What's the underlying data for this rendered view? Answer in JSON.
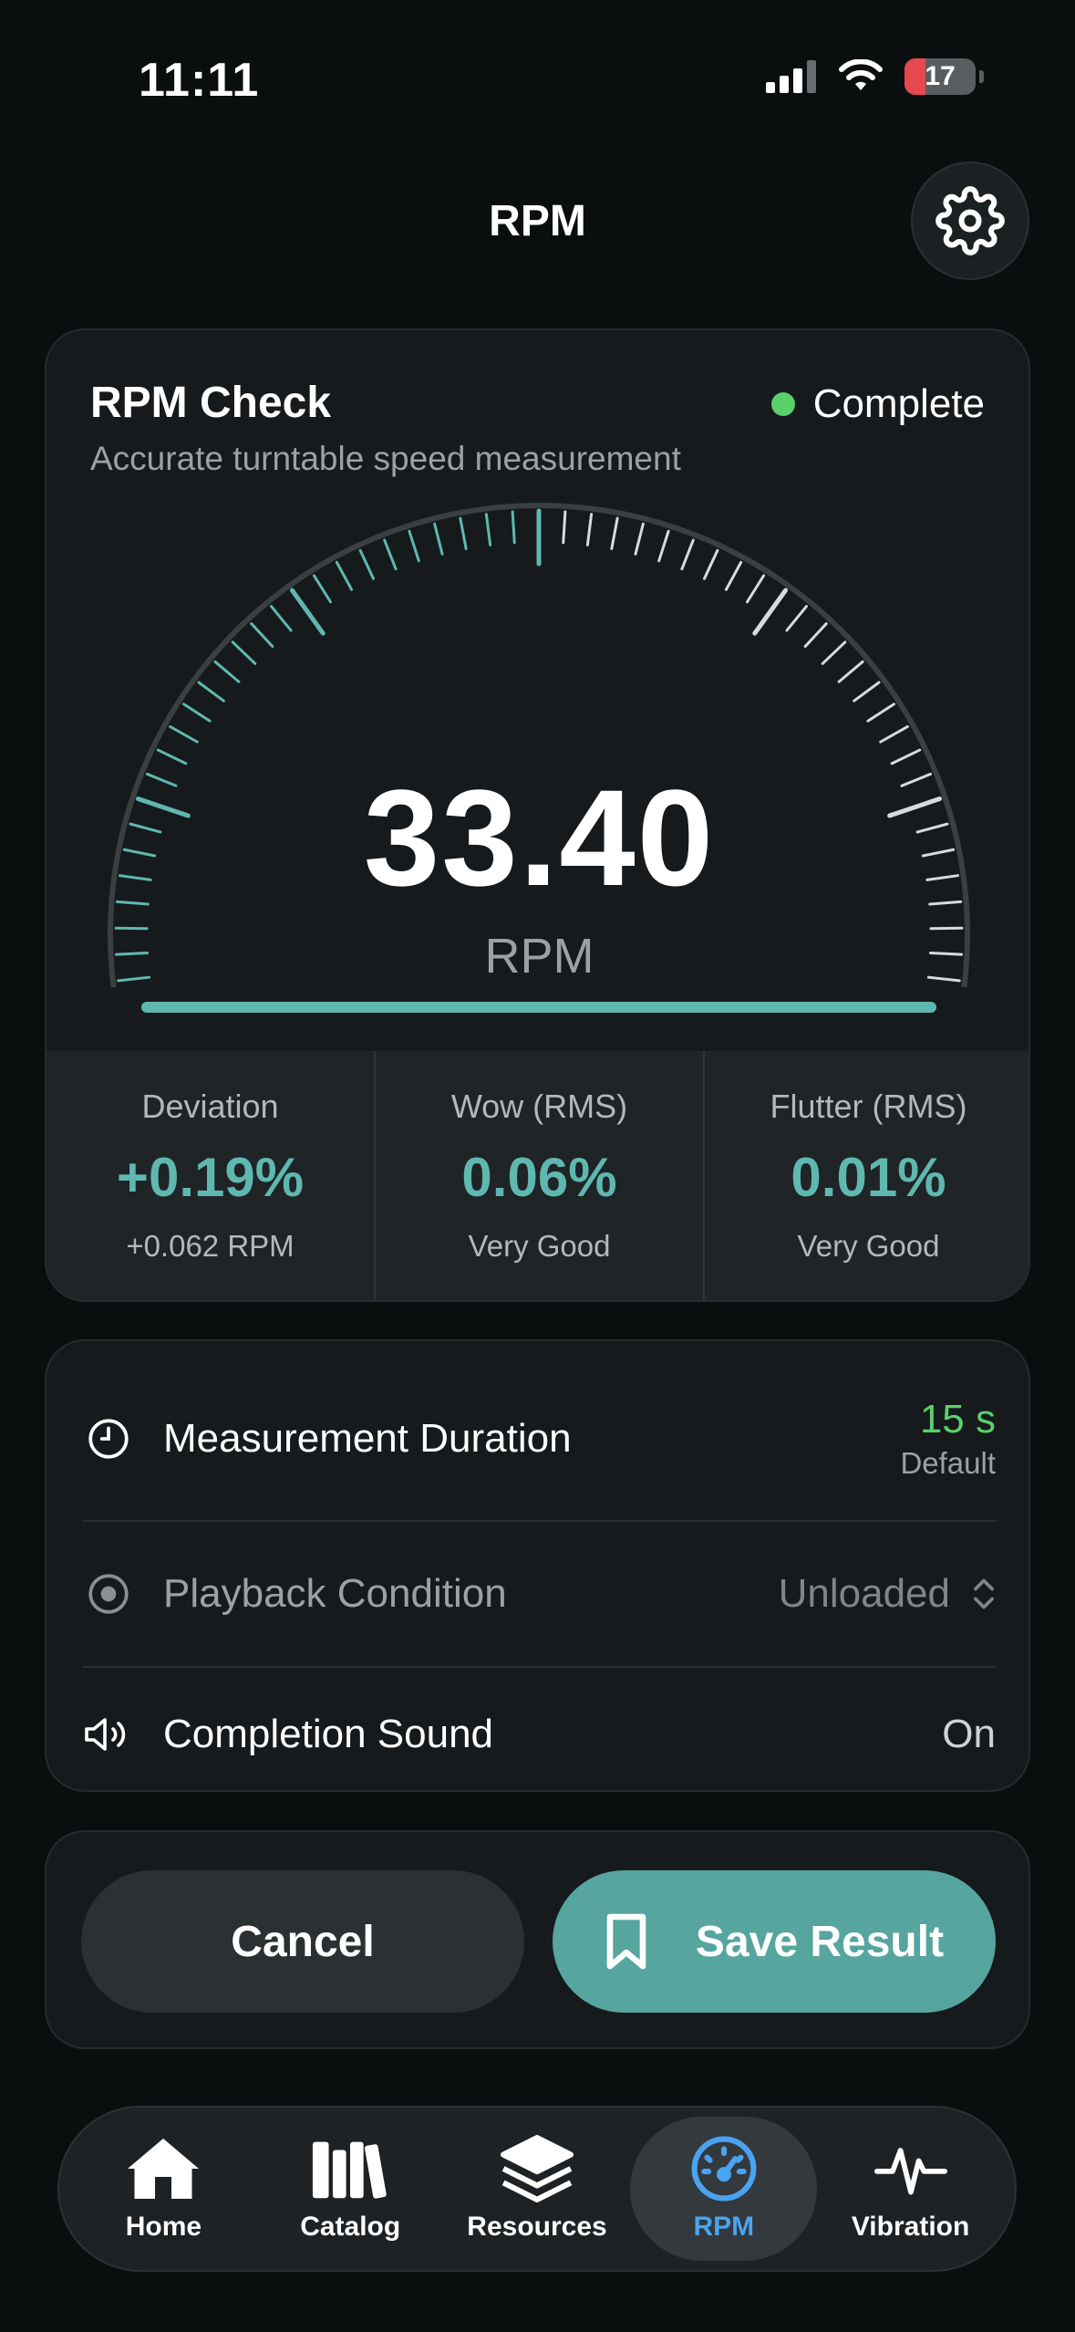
{
  "status_bar": {
    "time": "11:11",
    "battery": "17"
  },
  "header": {
    "title": "RPM"
  },
  "rpm_card": {
    "title": "RPM Check",
    "subtitle": "Accurate turntable speed measurement",
    "status": "Complete",
    "value": "33.40",
    "unit": "RPM"
  },
  "metrics": [
    {
      "label": "Deviation",
      "value": "+0.19%",
      "sub": "+0.062 RPM"
    },
    {
      "label": "Wow (RMS)",
      "value": "0.06%",
      "sub": "Very Good"
    },
    {
      "label": "Flutter (RMS)",
      "value": "0.01%",
      "sub": "Very Good"
    }
  ],
  "settings": {
    "duration": {
      "label": "Measurement Duration",
      "value": "15 s",
      "sub": "Default"
    },
    "playback": {
      "label": "Playback Condition",
      "value": "Unloaded"
    },
    "sound": {
      "label": "Completion Sound",
      "value": "On"
    }
  },
  "actions": {
    "cancel": "Cancel",
    "save": "Save Result"
  },
  "tabs": [
    {
      "label": "Home",
      "icon": "home-icon"
    },
    {
      "label": "Catalog",
      "icon": "books-icon"
    },
    {
      "label": "Resources",
      "icon": "layers-icon"
    },
    {
      "label": "RPM",
      "icon": "speedometer-icon"
    },
    {
      "label": "Vibration",
      "icon": "pulse-icon"
    }
  ],
  "colors": {
    "accent": "#5fb8b0",
    "complete": "#5ad06a",
    "active_tab": "#4aa3f0"
  }
}
